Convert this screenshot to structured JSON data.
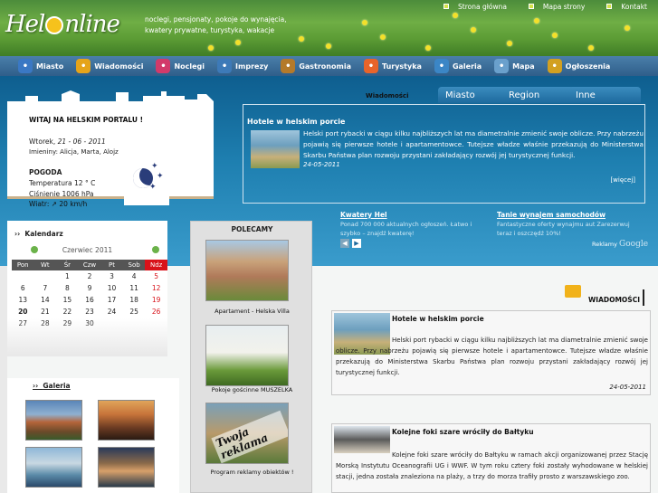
{
  "header": {
    "logo_text_pre": "Hel",
    "logo_text_post": "nline",
    "tagline": "noclegi, pensjonaty, pokoje do wynajęcia, kwatery prywatne, turystyka, wakacje",
    "top_links": [
      "Strona główna",
      "Mapa strony",
      "Kontakt"
    ]
  },
  "nav": {
    "items": [
      {
        "label": "Miasto",
        "icon": "info-icon",
        "color": "#3a78c4"
      },
      {
        "label": "Wiadomości",
        "icon": "speech-bubble-icon",
        "color": "#e5a41a"
      },
      {
        "label": "Noclegi",
        "icon": "stars-icon",
        "color": "#d23a6a"
      },
      {
        "label": "Imprezy",
        "icon": "calendar-icon",
        "color": "#3d7ab8"
      },
      {
        "label": "Gastronomia",
        "icon": "food-bowl-icon",
        "color": "#b47a2a"
      },
      {
        "label": "Turystyka",
        "icon": "beach-umbrella-icon",
        "color": "#e8642a"
      },
      {
        "label": "Galeria",
        "icon": "photo-icon",
        "color": "#3b86c6"
      },
      {
        "label": "Mapa",
        "icon": "compass-icon",
        "color": "#6aa0cc"
      },
      {
        "label": "Ogłoszenia",
        "icon": "people-icon",
        "color": "#d2a020"
      }
    ]
  },
  "welcome": {
    "title": "WITAJ NA HELSKIM PORTALU !",
    "date_prefix": "Wtorek,",
    "date": "21 - 06 - 2011",
    "names": "Imieniny: Alicja, Marta, Alojz",
    "weather_title": "POGODA",
    "temperature": "Temperatura 12 ° C",
    "pressure": "Ciśnienie 1006 hPa",
    "wind": "Wiatr: ↗ 20 km/h"
  },
  "news_tabs": {
    "label": "Wiadomości",
    "tabs": [
      "Miasto",
      "Region",
      "Inne"
    ]
  },
  "featured": {
    "title": "Hotele w helskim porcie",
    "text": "Helski port rybacki w ciągu kilku najbliższych lat ma diametralnie zmienić swoje oblicze. Przy nabrzeżu pojawią się pierwsze hotele i apartamentowce. Tutejsze władze właśnie przekazują do Ministerstwa Skarbu Państwa plan rozwoju przystani zakładający rozwój jej turystycznej funkcji.",
    "date": "24-05-2011",
    "more": "[więcej]"
  },
  "ads": [
    {
      "title": "Kwatery Hel",
      "text": "Ponad 700 000 aktualnych ogłoszeń. Łatwo i szybko – znajdź kwaterę!"
    },
    {
      "title": "Tanie wynajem samochodów",
      "text": "Fantastyczne oferty wynajmu aut Zarezerwuj teraz i oszczędź 10%!"
    }
  ],
  "ads_footer": {
    "prefix": "Reklamy",
    "brand": "Google"
  },
  "calendar": {
    "title": "Kalendarz",
    "month": "Czerwiec 2011",
    "days": [
      "Pon",
      "Wt",
      "Śr",
      "Czw",
      "Pt",
      "Sob",
      "Ndz"
    ],
    "weeks": [
      [
        "",
        "",
        "1",
        "2",
        "3",
        "4",
        "5"
      ],
      [
        "6",
        "7",
        "8",
        "9",
        "10",
        "11",
        "12"
      ],
      [
        "13",
        "14",
        "15",
        "16",
        "17",
        "18",
        "19"
      ],
      [
        "20",
        "21",
        "22",
        "23",
        "24",
        "25",
        "26"
      ],
      [
        "27",
        "28",
        "29",
        "30",
        "",
        "",
        ""
      ]
    ],
    "today": "20"
  },
  "polecamy": {
    "title": "POLECAMY",
    "items": [
      {
        "caption": "Apartament - Helska Villa"
      },
      {
        "caption": "Pokoje gościnne MUSZELKA"
      },
      {
        "caption": "Program reklamy obiektów !",
        "overlay": "Twoja reklama"
      }
    ]
  },
  "galeria": {
    "title": "Galeria"
  },
  "wiadomosci": {
    "header": "WIADOMOŚCI",
    "items": [
      {
        "title": "Hotele w helskim porcie",
        "text": "Helski port rybacki w ciągu kilku najbliższych lat ma diametralnie zmienić swoje oblicze. Przy nabrzeżu pojawią się pierwsze hotele i apartamentowce. Tutejsze władze właśnie przekazują do Ministerstwa Skarbu Państwa plan rozwoju przystani zakładający rozwój jej turystycznej funkcji.",
        "date": "24-05-2011"
      },
      {
        "title": "Kolejne foki szare wróciły do Bałtyku",
        "text": "Kolejne foki szare wróciły do Bałtyku w ramach akcji organizowanej przez Stację Morską Instytutu Oceanografii UG i WWF. W tym roku cztery foki zostały wyhodowane w helskiej stacji, jedna została znaleziona na plaży, a trzy do morza trafiły prosto z warszawskiego zoo."
      }
    ]
  }
}
